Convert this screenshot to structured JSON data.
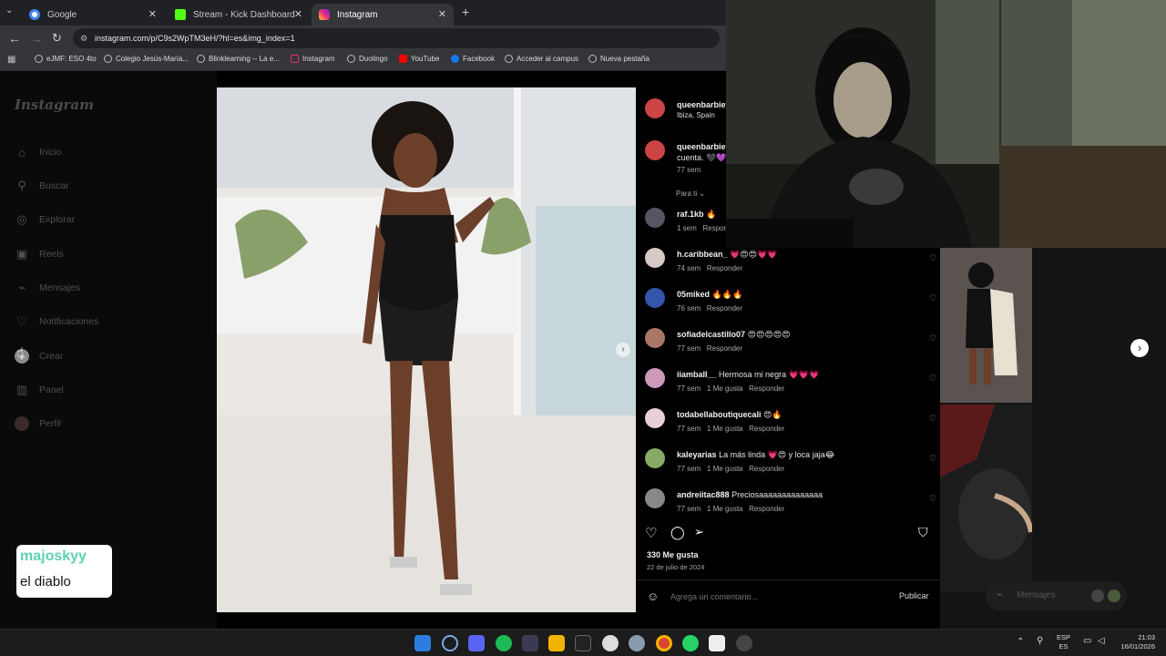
{
  "browser": {
    "tabs": [
      {
        "title": "Google",
        "icon": "google-icon",
        "color": "#4285f4"
      },
      {
        "title": "Stream - Kick Dashboard",
        "icon": "kick-icon",
        "color": "#53fc18"
      },
      {
        "title": "Instagram",
        "icon": "instagram-icon",
        "color": "#e1306c"
      }
    ],
    "url": "instagram.com/p/C9s2WpTM3eH/?hl=es&img_index=1",
    "bookmarks": [
      "eJMF: ESO 4to",
      "Colegio Jesús-María...",
      "Blinklearning -- La e...",
      "Instagram",
      "Duolingo",
      "YouTube",
      "Facebook",
      "Acceder al campus",
      "Nueva pestaña"
    ]
  },
  "sidebar": {
    "logo": "Instagram",
    "items": [
      {
        "label": "Inicio",
        "icon": "home-icon"
      },
      {
        "label": "Buscar",
        "icon": "search-icon"
      },
      {
        "label": "Explorar",
        "icon": "compass-icon"
      },
      {
        "label": "Reels",
        "icon": "reels-icon"
      },
      {
        "label": "Mensajes",
        "icon": "messenger-icon"
      },
      {
        "label": "Notificaciones",
        "icon": "heart-icon"
      },
      {
        "label": "Crear",
        "icon": "plus-icon"
      },
      {
        "label": "Panel",
        "icon": "chart-icon"
      },
      {
        "label": "Perfil",
        "icon": "avatar-icon"
      }
    ]
  },
  "post": {
    "author": "queenbarbiet",
    "location": "Ibiza, Spain",
    "caption_user": "queenbarbiet",
    "caption_text": "cuenta. 🖤💜",
    "caption_time": "77 sem",
    "sort_label": "Para ti",
    "likes": "330 Me gusta",
    "date": "22 de julio de 2024",
    "comment_placeholder": "Agrega un comentario...",
    "publish_label": "Publicar"
  },
  "comments": [
    {
      "user": "raf.1kb",
      "text": "🔥",
      "time": "1 sem",
      "likes": "",
      "reply": "Responder"
    },
    {
      "user": "h.caribbean_",
      "text": "💗😍😍💗💗",
      "time": "74 sem",
      "likes": "",
      "reply": "Responder"
    },
    {
      "user": "05miked",
      "text": "🔥🔥🔥",
      "time": "76 sem",
      "likes": "",
      "reply": "Responder"
    },
    {
      "user": "sofiadelcastillo07",
      "text": "😍😍😍😍😍",
      "time": "77 sem",
      "likes": "",
      "reply": "Responder"
    },
    {
      "user": "iiamball__",
      "text": "Hermosa mi negra 💗💗💗",
      "time": "77 sem",
      "likes": "1 Me gusta",
      "reply": "Responder"
    },
    {
      "user": "todabellaboutiquecali",
      "text": "😍🔥",
      "time": "77 sem",
      "likes": "1 Me gusta",
      "reply": "Responder"
    },
    {
      "user": "kaleyarias",
      "text": "La más linda 💗😍 y loca jaja😂",
      "time": "77 sem",
      "likes": "1 Me gusta",
      "reply": "Responder"
    },
    {
      "user": "andreiitac888",
      "text": "Preciosaaaaaaaaaaaaaa",
      "time": "77 sem",
      "likes": "1 Me gusta",
      "reply": "Responder"
    }
  ],
  "floating_messages": "Mensajes",
  "overlay": {
    "name": "majoskyy",
    "message": "el diablo"
  },
  "taskbar": {
    "lang_top": "ESP",
    "lang_bottom": "ES",
    "time": "21:03",
    "date": "16/01/2026"
  },
  "colors": {
    "ig_bg": "#000000",
    "accent_green": "#53fc18",
    "link_blue": "#0095f6"
  }
}
